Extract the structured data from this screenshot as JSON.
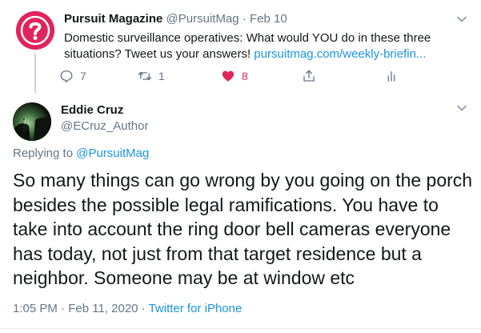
{
  "parent_tweet": {
    "author_name": "Pursuit Magazine",
    "author_handle": "@PursuitMag",
    "separator": "·",
    "date": "Feb 10",
    "text": "Domestic surveillance operatives: What would YOU do in these three situations? Tweet us your answers!",
    "link": "pursuitmag.com/weekly-briefin...",
    "reply_count": "7",
    "retweet_count": "1",
    "like_count": "8",
    "like_color": "#e0245e",
    "avatar_icon": "question-mark-icon"
  },
  "main_tweet": {
    "author_name": "Eddie Cruz",
    "author_handle": "@ECruz_Author",
    "replying_prefix": "Replying to",
    "replying_to": "@PursuitMag",
    "text": "So many things can go wrong by you going on the porch besides the possible legal ramifications. You have to take into account the ring door bell cameras everyone has today, not just from that target residence but a neighbor. Someone may be at window etc",
    "time": "1:05 PM",
    "separator": "·",
    "date": "Feb 11, 2020",
    "separator2": "·",
    "source": "Twitter for iPhone"
  },
  "colors": {
    "link": "#1b95e0",
    "muted": "#657786",
    "text": "#14171a"
  }
}
